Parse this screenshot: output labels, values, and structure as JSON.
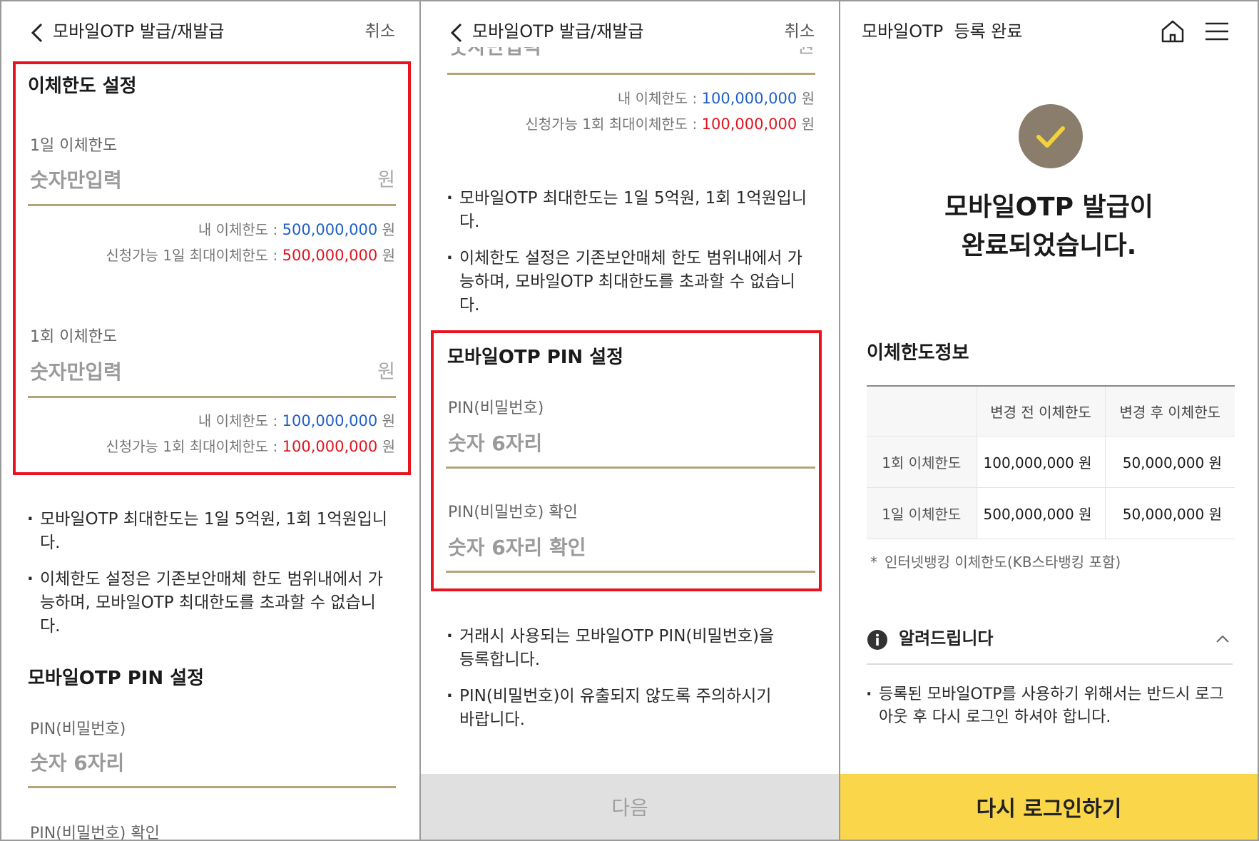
{
  "panel1": {
    "header": {
      "title": "모바일OTP 발급/재발급",
      "cancel": "취소"
    },
    "transfer_limit": {
      "title": "이체한도 설정",
      "daily": {
        "label": "1일 이체한도",
        "placeholder": "숫자만입력",
        "unit": "원",
        "my_limit_label": "내 이체한도 : ",
        "my_limit_value": "500,000,000",
        "max_label": "신청가능 1일 최대이체한도 : ",
        "max_value": "500,000,000",
        "won": "원"
      },
      "once": {
        "label": "1회 이체한도",
        "placeholder": "숫자만입력",
        "unit": "원",
        "my_limit_label": "내 이체한도 : ",
        "my_limit_value": "100,000,000",
        "max_label": "신청가능 1회 최대이체한도 : ",
        "max_value": "100,000,000",
        "won": "원"
      }
    },
    "notes": [
      "모바일OTP 최대한도는 1일 5억원, 1회 1억원입니다.",
      "이체한도 설정은 기존보안매체 한도 범위내에서 가능하며, 모바일OTP 최대한도를 초과할 수 없습니다."
    ],
    "pin": {
      "title": "모바일OTP PIN 설정",
      "pin_label": "PIN(비밀번호)",
      "pin_placeholder": "숫자 6자리",
      "confirm_label": "PIN(비밀번호) 확인"
    }
  },
  "panel2": {
    "header": {
      "title": "모바일OTP 발급/재발급",
      "cancel": "취소"
    },
    "partial_label": "숫자만입력",
    "partial_unit": "원",
    "limit": {
      "my_limit_label": "내 이체한도 : ",
      "my_limit_value": "100,000,000",
      "max_label": "신청가능 1회 최대이체한도 : ",
      "max_value": "100,000,000",
      "won": "원"
    },
    "notes": [
      "모바일OTP 최대한도는 1일 5억원, 1회 1억원입니다.",
      "이체한도 설정은 기존보안매체 한도 범위내에서 가능하며, 모바일OTP 최대한도를 초과할 수 없습니다."
    ],
    "pin": {
      "title": "모바일OTP PIN 설정",
      "pin_label": "PIN(비밀번호)",
      "pin_placeholder": "숫자 6자리",
      "confirm_label": "PIN(비밀번호) 확인",
      "confirm_placeholder": "숫자 6자리 확인"
    },
    "pin_notes": [
      "거래시 사용되는 모바일OTP PIN(비밀번호)을 등록합니다.",
      "PIN(비밀번호)이 유출되지 않도록 주의하시기 바랍니다."
    ],
    "next_button": "다음"
  },
  "panel3": {
    "header": {
      "title": "모바일OTP  등록 완료"
    },
    "done_line1": "모바일OTP 발급이",
    "done_line2": "완료되었습니다.",
    "info_title": "이체한도정보",
    "table": {
      "headers": [
        "",
        "변경 전 이체한도",
        "변경 후 이체한도"
      ],
      "rows": [
        [
          "1회 이체한도",
          "100,000,000 원",
          "50,000,000 원"
        ],
        [
          "1일 이체한도",
          "500,000,000 원",
          "50,000,000 원"
        ]
      ]
    },
    "footnote": "인터넷뱅킹 이체한도(KB스타뱅킹 포함)",
    "notice_title": "알려드립니다",
    "notice_text": "등록된 모바일OTP를 사용하기 위해서는 반드시 로그아웃 후 다시 로그인 하셔야 합니다.",
    "relogin_button": "다시 로그인하기"
  },
  "colors": {
    "accent_yellow": "#fad74a",
    "check_circle": "#8a7d6c",
    "check_mark": "#f5d23c",
    "highlight_red": "#e8131c",
    "field_line": "#b8a27c",
    "blue_value": "#1f5fc7",
    "red_value": "#e0141e"
  }
}
